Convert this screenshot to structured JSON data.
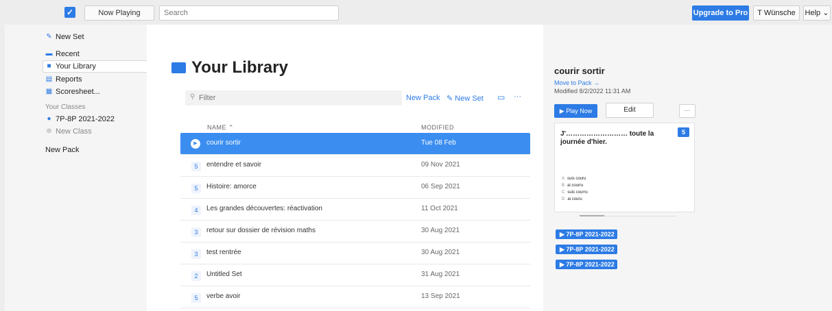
{
  "topbar": {
    "logo_glyph": "✓",
    "now_playing": "Now Playing",
    "search_placeholder": "Search",
    "upgrade": "Upgrade to Pro",
    "user": "T Wünsche",
    "help": "Help ⌄"
  },
  "sidebar": {
    "new_set": "New Set",
    "recent": "Recent",
    "your_library": "Your Library",
    "reports": "Reports",
    "scoresheet": "Scoresheet...",
    "your_classes": "Your Classes",
    "class1": "7P-8P 2021-2022",
    "new_class": "New Class",
    "new_pack": "New Pack"
  },
  "main": {
    "title": "Your Library",
    "filter_placeholder": "Filter",
    "new_pack": "New Pack",
    "new_set": "New Set",
    "more": "···",
    "col_name": "NAME ⌃",
    "col_modified": "MODIFIED",
    "rows": [
      {
        "count": "",
        "name": "courir sortir",
        "date": "Tue 08 Feb"
      },
      {
        "count": "5",
        "name": "entendre et savoir",
        "date": "09 Nov 2021"
      },
      {
        "count": "5",
        "name": "Histoire: amorce",
        "date": "06 Sep 2021"
      },
      {
        "count": "4",
        "name": "Les grandes découvertes: réactivation",
        "date": "11 Oct 2021"
      },
      {
        "count": "3",
        "name": "retour sur dossier de révision maths",
        "date": "30 Aug 2021"
      },
      {
        "count": "3",
        "name": "test rentrée",
        "date": "30 Aug 2021"
      },
      {
        "count": "2",
        "name": "Untitled Set",
        "date": "31 Aug 2021"
      },
      {
        "count": "5",
        "name": "verbe avoir",
        "date": "13 Sep 2021"
      }
    ]
  },
  "panel": {
    "title": "courir sortir",
    "move": "Move to Pack →",
    "modified": "Modified 8/2/2022 11:31 AM",
    "play_now": "▶ Play Now",
    "edit": "Edit",
    "more": "···",
    "question": "J'……………………… toute la journée d'hier.",
    "question_count": "5",
    "options": [
      {
        "letter": "A",
        "text": "suis couru"
      },
      {
        "letter": "B",
        "text": "ai courru"
      },
      {
        "letter": "C",
        "text": "suis courru"
      },
      {
        "letter": "D",
        "text": "ai couru"
      }
    ],
    "classes": [
      "▶ 7P-8P 2021-2022",
      "▶ 7P-8P 2021-2022",
      "▶ 7P-8P 2021-2022"
    ]
  }
}
